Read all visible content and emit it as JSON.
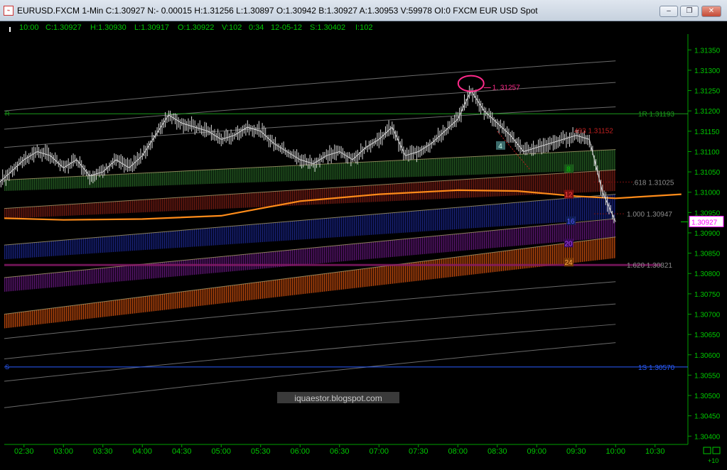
{
  "window": {
    "title": "EURUSD.FXCM 1-Min C:1.30927 N:- 0.00015 H:1.31256 L:1.30897 O:1.30942 B:1.30927 A:1.30953 V:59978 OI:0 FXCM EUR USD Spot",
    "icon": "chart-app-icon",
    "buttons": {
      "minimize": "minimize-icon",
      "restore": "restore-icon",
      "close": "close-icon"
    }
  },
  "status_bar": {
    "time": "10:00",
    "close": "C:1.30927",
    "high": "H:1.30930",
    "low": "L:1.30917",
    "open": "O:1.30922",
    "volume": "V:102",
    "bar_time": "0:34",
    "date": "12-05-12",
    "settle": "S:1.30402",
    "open_interest": "I:102"
  },
  "colors": {
    "background": "#000000",
    "axis_text": "#00c800",
    "price_bars": "#d8d8d8",
    "resistance_line": "#1a9c1a",
    "support_line": "#2a5cff",
    "moving_average": "#ff8c1a",
    "highlight_ellipse": "#ff2a8a",
    "last_price_box": "#ff00ff"
  },
  "chart_data": {
    "type": "line",
    "series": [
      {
        "name": "EURUSD.FXCM 1-Min",
        "x": [
          "02:00",
          "02:10",
          "02:20",
          "02:30",
          "02:40",
          "02:50",
          "03:00",
          "03:10",
          "03:20",
          "03:30",
          "03:40",
          "03:50",
          "04:00",
          "04:10",
          "04:20",
          "04:30",
          "04:40",
          "04:50",
          "05:00",
          "05:10",
          "05:20",
          "05:30",
          "05:40",
          "05:50",
          "06:00",
          "06:10",
          "06:20",
          "06:30",
          "06:40",
          "06:50",
          "07:00",
          "07:10",
          "07:20",
          "07:30",
          "07:40",
          "07:50",
          "08:00",
          "08:10",
          "08:20",
          "08:30",
          "08:40",
          "08:50",
          "09:00",
          "09:10",
          "09:20",
          "09:30",
          "09:40",
          "09:50",
          "10:00"
        ],
        "values": [
          1.3099,
          1.3102,
          1.3105,
          1.3108,
          1.311,
          1.3109,
          1.3106,
          1.3108,
          1.3104,
          1.3105,
          1.3108,
          1.3106,
          1.3109,
          1.3114,
          1.3119,
          1.3117,
          1.3116,
          1.3115,
          1.3113,
          1.3114,
          1.3116,
          1.3115,
          1.3112,
          1.311,
          1.3108,
          1.3107,
          1.3109,
          1.311,
          1.3108,
          1.3111,
          1.3113,
          1.3116,
          1.3109,
          1.311,
          1.3112,
          1.3115,
          1.3118,
          1.3125,
          1.312,
          1.3117,
          1.3114,
          1.311,
          1.3111,
          1.3112,
          1.3113,
          1.3114,
          1.3113,
          1.31,
          1.30927
        ]
      }
    ],
    "xticks": [
      "02:30",
      "03:00",
      "03:30",
      "04:00",
      "04:30",
      "05:00",
      "05:30",
      "06:00",
      "06:30",
      "07:00",
      "07:30",
      "08:00",
      "08:30",
      "09:00",
      "09:30",
      "10:00",
      "10:30"
    ],
    "yticks": [
      "1.31350",
      "1.31300",
      "1.31250",
      "1.31200",
      "1.31150",
      "1.31100",
      "1.31050",
      "1.31000",
      "1.30950",
      "1.30900",
      "1.30850",
      "1.30800",
      "1.30750",
      "1.30700",
      "1.30650",
      "1.30600",
      "1.30550",
      "1.30500",
      "1.30450",
      "1.30400"
    ],
    "ylim": [
      1.3039,
      1.31375
    ],
    "grid": false,
    "levels": {
      "resistance": {
        "label": "1R  1.31193",
        "value": 1.31193,
        "axis_tag": "R"
      },
      "support": {
        "label": "1S  1.30570",
        "value": 1.3057,
        "axis_tag": "S"
      },
      "peak": {
        "label": "1. 31257",
        "value": 1.31257
      },
      "fib_high": {
        "label": "493  1.31152",
        "value": 1.31152
      },
      "fib_618": {
        "label": ".618  1.31025",
        "value": 1.31025
      },
      "fib_1000": {
        "label": "1.000  1.30947",
        "value": 1.30947
      },
      "fib_1620": {
        "label": "1.620  1.30821",
        "value": 1.30821
      }
    },
    "band_markers": [
      "4",
      "8",
      "12",
      "16",
      "20",
      "24"
    ],
    "last_price": "1.30927",
    "corner_label": "+10",
    "watermark": "iquaestor.blogspot.com"
  }
}
